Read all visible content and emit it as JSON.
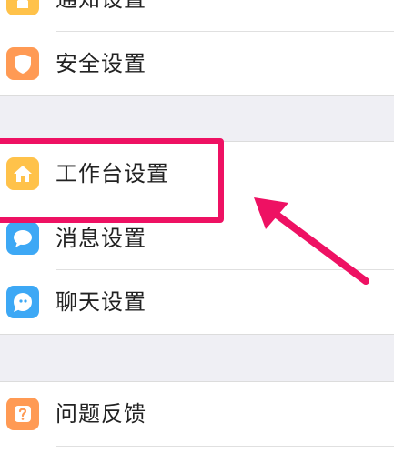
{
  "settings": {
    "group1": [
      {
        "label": "通知设置",
        "icon": "bell-icon",
        "color": "#ffc24a"
      },
      {
        "label": "安全设置",
        "icon": "shield-icon",
        "color": "#ff9a54"
      }
    ],
    "group2": [
      {
        "label": "工作台设置",
        "icon": "home-icon",
        "color": "#ffc24a"
      },
      {
        "label": "消息设置",
        "icon": "chat-bubble-icon",
        "color": "#3da8f5"
      },
      {
        "label": "聊天设置",
        "icon": "chat-face-icon",
        "color": "#3da8f5"
      }
    ],
    "group3": [
      {
        "label": "问题反馈",
        "icon": "question-icon",
        "color": "#ff9a54"
      }
    ]
  },
  "annotation": {
    "highlight_color": "#ee1163",
    "highlighted_item": "工作台设置"
  }
}
